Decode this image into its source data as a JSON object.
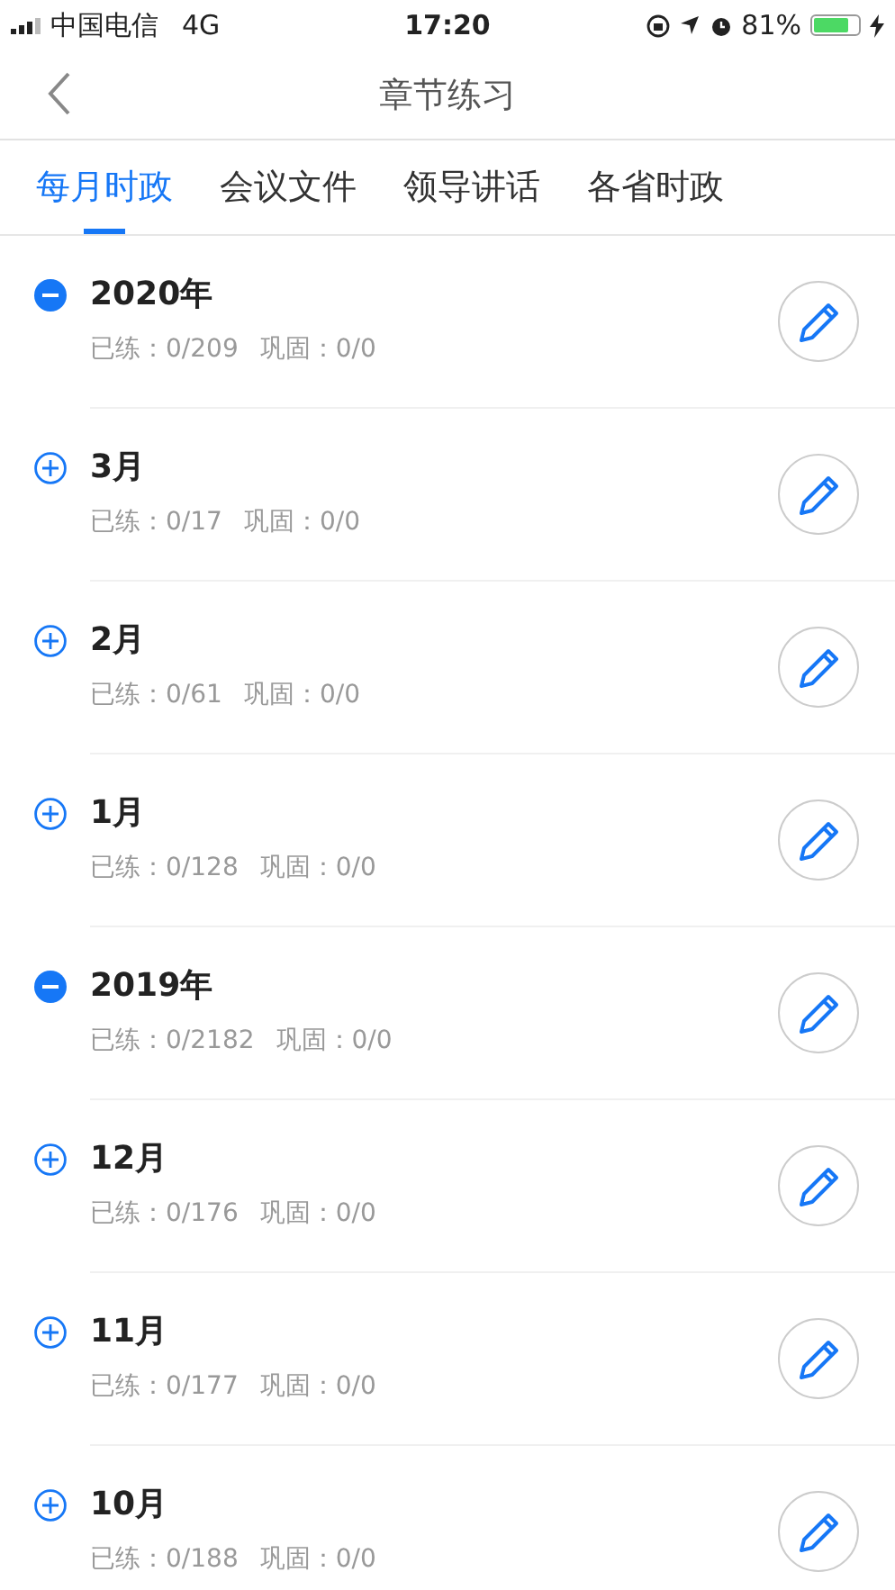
{
  "status_bar": {
    "carrier": "中国电信",
    "network": "4G",
    "time": "17:20",
    "battery": "81%"
  },
  "nav": {
    "title": "章节练习"
  },
  "tabs": [
    {
      "label": "每月时政",
      "selected": true
    },
    {
      "label": "会议文件",
      "selected": false
    },
    {
      "label": "领导讲话",
      "selected": false
    },
    {
      "label": "各省时政",
      "selected": false
    }
  ],
  "items": [
    {
      "title": "2020年",
      "expanded": true,
      "practiced": "已练：0/209",
      "consolidated": "巩固：0/0"
    },
    {
      "title": "3月",
      "expanded": false,
      "practiced": "已练：0/17",
      "consolidated": "巩固：0/0"
    },
    {
      "title": "2月",
      "expanded": false,
      "practiced": "已练：0/61",
      "consolidated": "巩固：0/0"
    },
    {
      "title": "1月",
      "expanded": false,
      "practiced": "已练：0/128",
      "consolidated": "巩固：0/0"
    },
    {
      "title": "2019年",
      "expanded": true,
      "practiced": "已练：0/2182",
      "consolidated": "巩固：0/0"
    },
    {
      "title": "12月",
      "expanded": false,
      "practiced": "已练：0/176",
      "consolidated": "巩固：0/0"
    },
    {
      "title": "11月",
      "expanded": false,
      "practiced": "已练：0/177",
      "consolidated": "巩固：0/0"
    },
    {
      "title": "10月",
      "expanded": false,
      "practiced": "已练：0/188",
      "consolidated": "巩固：0/0"
    }
  ]
}
